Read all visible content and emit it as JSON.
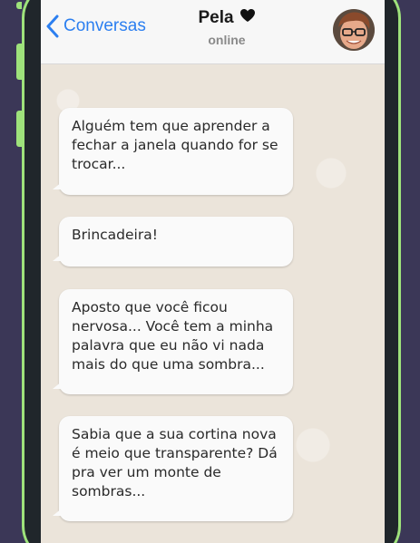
{
  "header": {
    "back_label": "Conversas",
    "contact_name": "Pela",
    "contact_status": "online"
  },
  "icons": {
    "back": "chevron-left-icon",
    "heart": "heart-icon",
    "avatar": "contact-avatar"
  },
  "colors": {
    "accent": "#2c7ff0",
    "frame": "#9ee27b",
    "background": "#3b3757",
    "chat_bg": "#ebe4da",
    "bubble": "#fafafa"
  },
  "messages": [
    {
      "text": "Alguém tem que aprender a fechar a janela quando for se trocar..."
    },
    {
      "text": "Brincadeira!"
    },
    {
      "text": "Aposto que você ficou nervosa... Você tem a minha palavra que eu não vi nada mais do que uma sombra..."
    },
    {
      "text": "Sabia que a sua cortina nova é meio que transparente? Dá pra ver um monte de sombras..."
    }
  ]
}
